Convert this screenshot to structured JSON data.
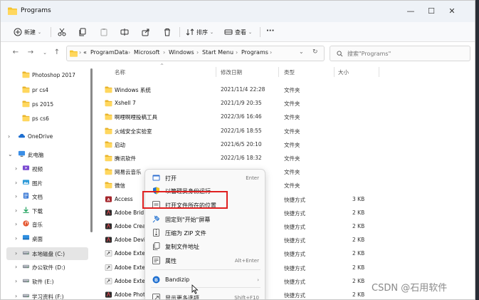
{
  "window": {
    "title": "Programs"
  },
  "toolbar": {
    "new_label": "新建",
    "sort_label": "排序",
    "view_label": "查看",
    "more_label": "···"
  },
  "address": {
    "crumbs": [
      "«",
      "ProgramData",
      "Microsoft",
      "Windows",
      "Start Menu",
      "Programs"
    ],
    "search_placeholder": "搜索\"Programs\""
  },
  "sidebar": {
    "items": [
      {
        "label": "Photoshop 2017",
        "icon": "folder-icon",
        "chevron": ""
      },
      {
        "label": "pr cs4",
        "icon": "folder-icon",
        "chevron": ""
      },
      {
        "label": "ps 2015",
        "icon": "folder-icon",
        "chevron": ""
      },
      {
        "label": "ps cs6",
        "icon": "folder-icon",
        "chevron": ""
      },
      {
        "label": "OneDrive",
        "icon": "cloud-icon",
        "chevron": ">"
      },
      {
        "label": "此电脑",
        "icon": "pc-icon",
        "chevron": "v"
      },
      {
        "label": "视频",
        "icon": "video-icon",
        "chevron": ">"
      },
      {
        "label": "图片",
        "icon": "picture-icon",
        "chevron": ">"
      },
      {
        "label": "文档",
        "icon": "document-icon",
        "chevron": ">"
      },
      {
        "label": "下载",
        "icon": "download-icon",
        "chevron": ">"
      },
      {
        "label": "音乐",
        "icon": "music-icon",
        "chevron": ">"
      },
      {
        "label": "桌面",
        "icon": "desktop-icon",
        "chevron": ">"
      },
      {
        "label": "本地磁盘 (C:)",
        "icon": "drive-icon",
        "chevron": ">"
      },
      {
        "label": "办公软件 (D:)",
        "icon": "drive-icon",
        "chevron": ">"
      },
      {
        "label": "软件 (E:)",
        "icon": "drive-icon",
        "chevron": ">"
      },
      {
        "label": "学习资料 (F:)",
        "icon": "drive-icon",
        "chevron": ">"
      }
    ]
  },
  "list": {
    "columns": {
      "name": "名称",
      "date": "修改日期",
      "type": "类型",
      "size": "大小"
    },
    "rows": [
      {
        "name": "Windows 系统",
        "date": "2021/11/4 22:28",
        "type": "文件夹",
        "size": "",
        "icon": "folder-icon"
      },
      {
        "name": "Xshell 7",
        "date": "2021/1/9 20:35",
        "type": "文件夹",
        "size": "",
        "icon": "folder-icon"
      },
      {
        "name": "啊哩啊哩投稿工具",
        "date": "2022/3/6 16:46",
        "type": "文件夹",
        "size": "",
        "icon": "folder-icon"
      },
      {
        "name": "火绒安全实验室",
        "date": "2022/1/6 18:55",
        "type": "文件夹",
        "size": "",
        "icon": "folder-icon"
      },
      {
        "name": "启动",
        "date": "2021/6/5 20:10",
        "type": "文件夹",
        "size": "",
        "icon": "folder-icon"
      },
      {
        "name": "腾讯软件",
        "date": "2022/1/6 18:32",
        "type": "文件夹",
        "size": "",
        "icon": "folder-icon"
      },
      {
        "name": "网易云音乐",
        "date": "",
        "type": "文件夹",
        "size": "",
        "icon": "folder-icon"
      },
      {
        "name": "微信",
        "date": "",
        "type": "文件夹",
        "size": "",
        "icon": "folder-icon"
      },
      {
        "name": "Access",
        "date": "",
        "type": "快捷方式",
        "size": "3 KB",
        "icon": "access-icon"
      },
      {
        "name": "Adobe Brid",
        "date": "",
        "type": "快捷方式",
        "size": "2 KB",
        "icon": "adobe-icon"
      },
      {
        "name": "Adobe Crea",
        "date": "",
        "type": "快捷方式",
        "size": "2 KB",
        "icon": "adobe-icon"
      },
      {
        "name": "Adobe Devi",
        "date": "",
        "type": "快捷方式",
        "size": "2 KB",
        "icon": "adobe-icon"
      },
      {
        "name": "Adobe Exte",
        "date": "",
        "type": "快捷方式",
        "size": "2 KB",
        "icon": "shortcut-icon"
      },
      {
        "name": "Adobe Exte",
        "date": "",
        "type": "快捷方式",
        "size": "2 KB",
        "icon": "shortcut-icon"
      },
      {
        "name": "Adobe Exte",
        "date": "",
        "type": "快捷方式",
        "size": "2 KB",
        "icon": "shortcut-icon"
      },
      {
        "name": "Adobe Phot",
        "date": "",
        "type": "快捷方式",
        "size": "2 KB",
        "icon": "adobe-icon"
      }
    ]
  },
  "context_menu": {
    "items": [
      {
        "label": "打开",
        "shortcut": "Enter",
        "icon": "open-icon"
      },
      {
        "label": "以管理员身份运行",
        "shortcut": "",
        "icon": "shield-icon"
      },
      {
        "label": "打开文件所在的位置",
        "shortcut": "",
        "icon": "folder-open-icon"
      },
      {
        "label": "固定到\"开始\"屏幕",
        "shortcut": "",
        "icon": "pin-icon"
      },
      {
        "label": "压缩为 ZIP 文件",
        "shortcut": "",
        "icon": "zip-icon"
      },
      {
        "label": "复制文件地址",
        "shortcut": "",
        "icon": "copy-path-icon"
      },
      {
        "label": "属性",
        "shortcut": "Alt+Enter",
        "icon": "properties-icon"
      },
      {
        "label": "Bandizip",
        "shortcut": "›",
        "icon": "bandizip-icon"
      },
      {
        "label": "显示更多选项",
        "shortcut": "Shift+F10",
        "icon": "more-options-icon"
      }
    ]
  },
  "watermark": "CSDN @石用软件",
  "colors": {
    "accent": "#0067c0",
    "folder": "#f4c430",
    "highlight": "#e02020"
  }
}
